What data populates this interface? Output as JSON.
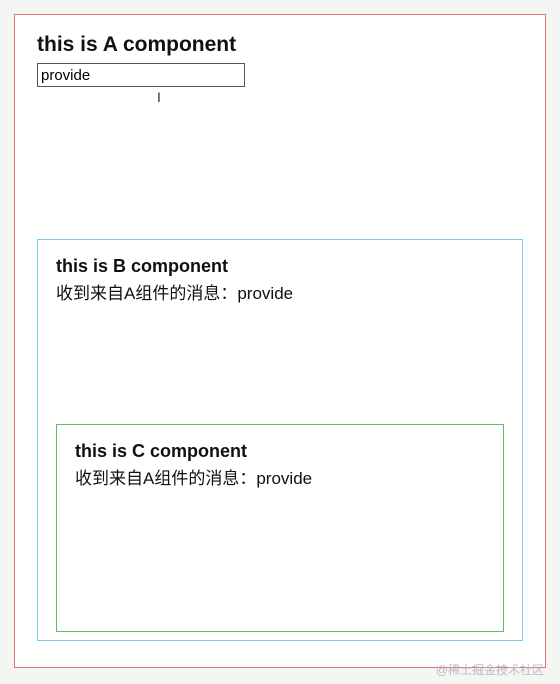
{
  "componentA": {
    "title": "this is A component",
    "inputValue": "provide"
  },
  "componentB": {
    "title": "this is B component",
    "messagePrefix": "收到来自A组件的消息：",
    "messageValue": "provide"
  },
  "componentC": {
    "title": "this is C component",
    "messagePrefix": "收到来自A组件的消息：",
    "messageValue": "provide"
  },
  "watermark": "@稀土掘金技术社区"
}
